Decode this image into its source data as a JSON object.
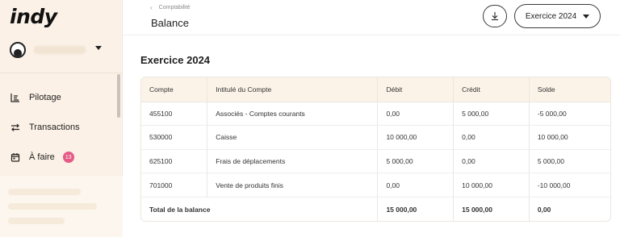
{
  "app": {
    "logo": "indy"
  },
  "sidebar": {
    "items": [
      {
        "label": "Pilotage",
        "icon": "chart-lines-icon"
      },
      {
        "label": "Transactions",
        "icon": "swap-arrows-icon"
      },
      {
        "label": "À faire",
        "icon": "calendar-icon",
        "badge": "13"
      }
    ]
  },
  "header": {
    "breadcrumb": "Comptabilité",
    "title": "Balance",
    "year_select": "Exercice 2024"
  },
  "main": {
    "section_title": "Exercice 2024",
    "table": {
      "columns": [
        "Compte",
        "Intitulé du Compte",
        "Débit",
        "Crédit",
        "Solde"
      ],
      "rows": [
        [
          "455100",
          "Associés - Comptes courants",
          "0,00",
          "5 000,00",
          "-5 000,00"
        ],
        [
          "530000",
          "Caisse",
          "10 000,00",
          "0,00",
          "10 000,00"
        ],
        [
          "625100",
          "Frais de déplacements",
          "5 000,00",
          "0,00",
          "5 000,00"
        ],
        [
          "701000",
          "Vente de produits finis",
          "0,00",
          "10 000,00",
          "-10 000,00"
        ]
      ],
      "total": {
        "label": "Total de la balance",
        "debit": "15 000,00",
        "credit": "15 000,00",
        "solde": "0,00"
      }
    }
  },
  "colors": {
    "sidebar_bg": "#fbf1e6",
    "table_header_bg": "#fbf3e8",
    "badge": "#e55b86"
  }
}
